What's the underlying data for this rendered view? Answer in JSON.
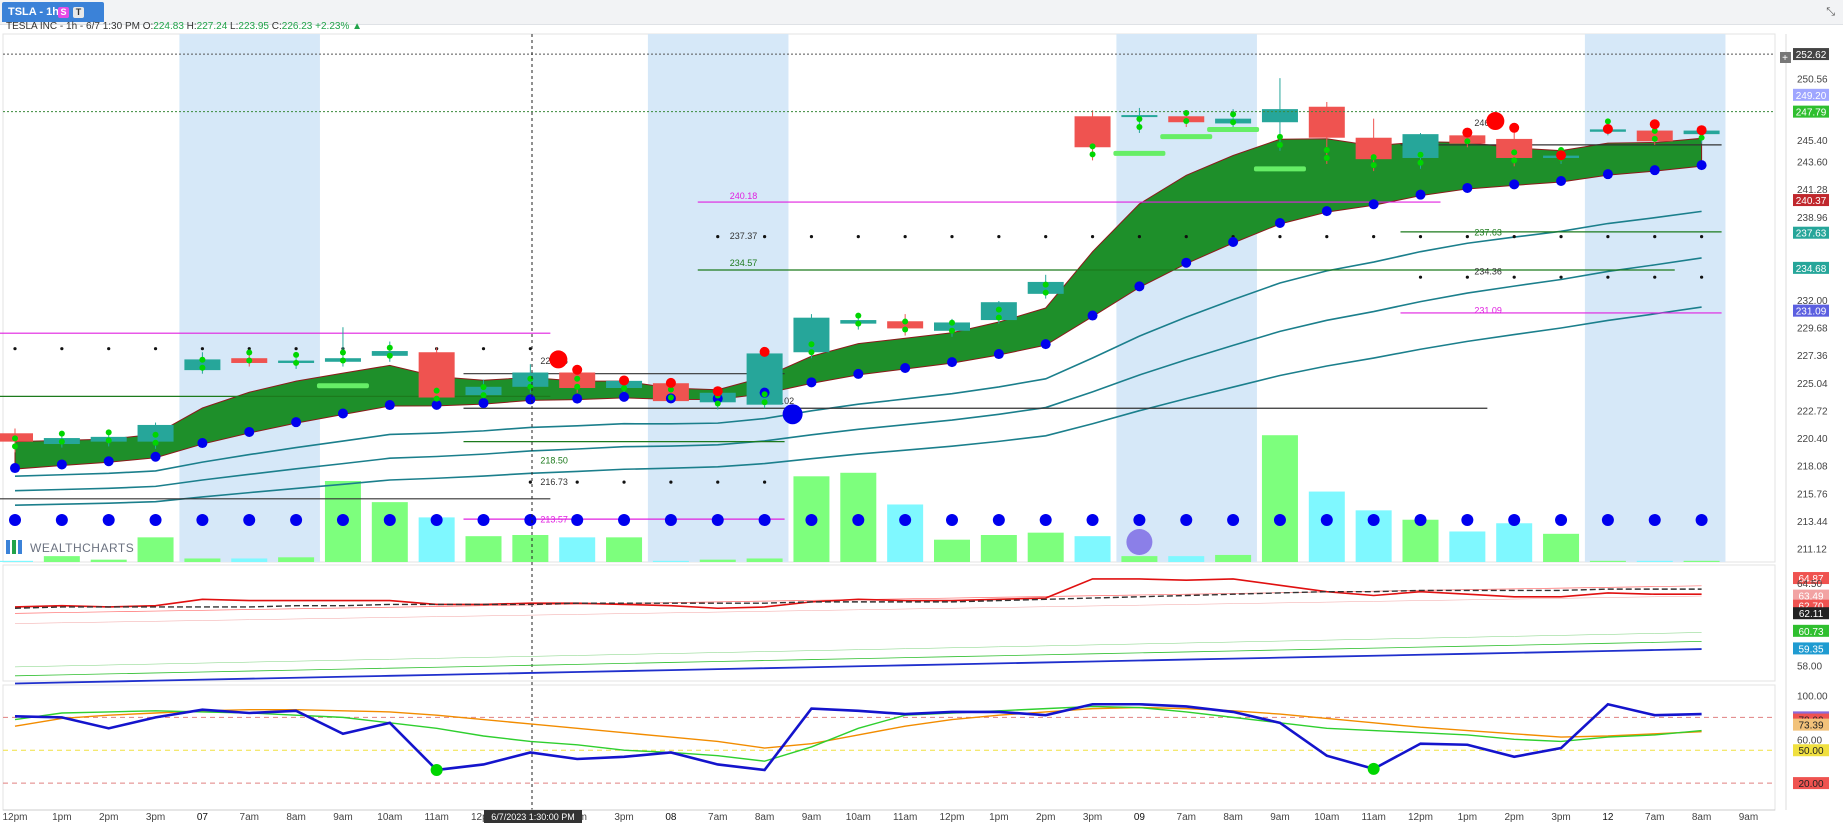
{
  "tab": {
    "label": "TSLA - 1hr",
    "badge_s": "S",
    "badge_t": "T"
  },
  "top_right_icon": "expand-icon",
  "info": {
    "title": "TESLA INC - 1h - 6/7 1:30 PM",
    "o_label": "O:",
    "o_value": "224.83",
    "h_label": "H:",
    "h_value": "227.24",
    "l_label": "L:",
    "l_value": "223.95",
    "c_label": "C:",
    "c_value": "226.23",
    "change": "+2.23%",
    "arrow": "▲"
  },
  "watermark": "WEALTHCHARTS",
  "crosshair_label": "6/7/2023 1:30:00 PM",
  "colors": {
    "up": "#26a69a",
    "down": "#ef5350",
    "cloud": "#1e8f2a",
    "session": "#d6e8f8",
    "volume_up": "#7dff7d",
    "volume_down": "#7ff8ff",
    "dots_blue": "#0000ee",
    "dots_red": "#ff0000",
    "dots_green": "#00d600",
    "magenta": "#e020e0"
  },
  "chart_data": [
    {
      "type": "candlestick",
      "x": [
        "12pm",
        "1pm",
        "2pm",
        "3pm",
        "07",
        "7am",
        "8am",
        "9am",
        "10am",
        "11am",
        "12pm",
        "1pm",
        "2pm",
        "3pm",
        "08",
        "7am",
        "8am",
        "9am",
        "10am",
        "11am",
        "12pm",
        "1pm",
        "2pm",
        "3pm",
        "09",
        "7am",
        "8am",
        "9am",
        "10am",
        "11am",
        "12pm",
        "1pm",
        "2pm",
        "3pm",
        "12",
        "7am",
        "8am"
      ],
      "ohlc": [
        [
          220.8,
          221.2,
          219.2,
          220.1
        ],
        [
          219.9,
          220.7,
          219.6,
          220.4
        ],
        [
          220.1,
          220.7,
          219.7,
          220.5
        ],
        [
          220.1,
          221.7,
          219.5,
          221.5
        ],
        [
          226.1,
          227.6,
          225.8,
          227.0
        ],
        [
          227.1,
          227.5,
          226.4,
          226.7
        ],
        [
          226.7,
          227.1,
          226.2,
          226.9
        ],
        [
          226.8,
          229.7,
          226.4,
          227.1
        ],
        [
          227.3,
          228.5,
          226.8,
          227.7
        ],
        [
          227.6,
          228.0,
          223.2,
          223.8
        ],
        [
          224.0,
          225.3,
          223.5,
          224.7
        ],
        [
          224.7,
          226.6,
          224.2,
          225.9
        ],
        [
          225.9,
          226.3,
          224.2,
          224.6
        ],
        [
          224.6,
          225.4,
          224.1,
          225.2
        ],
        [
          225.0,
          225.2,
          223.3,
          223.5
        ],
        [
          223.4,
          224.5,
          222.8,
          224.2
        ],
        [
          223.2,
          227.8,
          222.9,
          227.5
        ],
        [
          227.6,
          230.8,
          227.1,
          230.5
        ],
        [
          230.0,
          230.7,
          229.5,
          230.3
        ],
        [
          230.2,
          230.8,
          229.0,
          229.6
        ],
        [
          229.4,
          230.4,
          228.9,
          230.1
        ],
        [
          230.3,
          231.9,
          230.0,
          231.8
        ],
        [
          232.5,
          234.1,
          232.1,
          233.5
        ],
        [
          247.4,
          247.9,
          243.7,
          244.8
        ],
        [
          247.4,
          248.1,
          246.0,
          247.5
        ],
        [
          247.4,
          247.9,
          246.5,
          246.9
        ],
        [
          246.8,
          248.0,
          246.4,
          247.2
        ],
        [
          246.9,
          250.6,
          244.5,
          248.0
        ],
        [
          248.2,
          248.6,
          243.4,
          245.6
        ],
        [
          245.6,
          247.2,
          242.8,
          243.8
        ],
        [
          243.9,
          246.0,
          243.0,
          245.9
        ],
        [
          245.8,
          246.2,
          244.8,
          245.1
        ],
        [
          245.5,
          246.6,
          243.2,
          243.9
        ],
        [
          243.9,
          244.3,
          243.4,
          244.1
        ],
        [
          246.1,
          246.5,
          245.8,
          246.3
        ],
        [
          246.2,
          246.9,
          245.0,
          245.3
        ],
        [
          245.9,
          246.4,
          245.1,
          246.2
        ]
      ],
      "volume": [
        0.1,
        0.5,
        0.2,
        2.1,
        0.3,
        0.3,
        0.4,
        6.9,
        5.1,
        3.8,
        2.2,
        2.3,
        2.1,
        2.1,
        0.1,
        0.2,
        0.3,
        7.3,
        7.6,
        4.9,
        1.9,
        2.3,
        2.5,
        2.2,
        0.5,
        0.5,
        0.6,
        10.8,
        6.0,
        4.4,
        3.6,
        2.6,
        3.3,
        2.4,
        0.1,
        0.1,
        0.1
      ],
      "axis_labels": [
        "252.62",
        "250.56",
        "249.20",
        "247.79",
        "245.40",
        "243.60",
        "241.28",
        "240.37",
        "238.96",
        "237.63",
        "234.68",
        "232.00",
        "231.09",
        "229.68",
        "227.36",
        "225.04",
        "222.72",
        "220.40",
        "218.08",
        "215.76",
        "213.44",
        "211.12"
      ],
      "price_labels": {
        "p240_18": "240.18",
        "p237_37": "237.37",
        "p234_57": "234.57",
        "p226_36": "226.36",
        "p223_02": "223.02",
        "p218_50": "218.50",
        "p216_73": "216.73",
        "p213_57": "213.57",
        "p246_84": "246.84",
        "p237_63": "237.63",
        "p234_36": "234.36",
        "p231_09": "231.09"
      },
      "ylim": [
        210,
        253.8
      ]
    },
    {
      "type": "line",
      "axis_labels": [
        "64.87",
        "64.50",
        "63.49",
        "62.70",
        "62.11",
        "60.73",
        "59.35",
        "58.00"
      ],
      "series": [
        {
          "values": [
            62.6,
            62.7,
            62.6,
            62.7,
            63.2,
            63.1,
            63.1,
            63.1,
            63.1,
            62.8,
            62.8,
            62.9,
            62.9,
            62.8,
            62.7,
            62.5,
            62.6,
            63.0,
            63.2,
            63.1,
            63.1,
            63.2,
            63.3,
            64.8,
            64.8,
            64.7,
            64.8,
            64.3,
            63.8,
            63.5,
            63.8,
            63.6,
            63.4,
            63.4,
            63.7,
            63.6,
            63.6
          ]
        },
        {
          "values": [
            62.5,
            62.6,
            62.6,
            62.6,
            62.6,
            62.6,
            62.7,
            62.7,
            62.8,
            62.8,
            62.8,
            62.8,
            62.9,
            62.9,
            62.9,
            62.9,
            62.9,
            63.0,
            63.0,
            63.0,
            63.0,
            63.1,
            63.2,
            63.3,
            63.4,
            63.5,
            63.6,
            63.7,
            63.8,
            63.8,
            63.9,
            63.9,
            63.9,
            63.9,
            64.0,
            64.0,
            64.0
          ]
        }
      ]
    },
    {
      "type": "line",
      "axis_labels": [
        "100.00",
        "80.00",
        "78.00",
        "73.39",
        "60.00",
        "50.00",
        "20.00"
      ],
      "series": [
        {
          "values": [
            81,
            80,
            70,
            80,
            87,
            84,
            86,
            65,
            75,
            32,
            37,
            48,
            42,
            44,
            48,
            37,
            32,
            88,
            86,
            83,
            85,
            85,
            82,
            92,
            92,
            90,
            85,
            75,
            45,
            33,
            56,
            55,
            44,
            52,
            92,
            82,
            83
          ]
        },
        {
          "values": [
            78,
            84,
            85,
            86,
            85,
            84,
            82,
            80,
            75,
            70,
            63,
            58,
            55,
            50,
            48,
            45,
            40,
            53,
            70,
            82,
            84,
            86,
            88,
            90,
            89,
            85,
            80,
            75,
            70,
            68,
            66,
            64,
            60,
            58,
            62,
            64,
            68
          ]
        },
        {
          "values": [
            72,
            79,
            82,
            84,
            86,
            87,
            87,
            86,
            85,
            82,
            78,
            74,
            70,
            66,
            62,
            58,
            52,
            56,
            64,
            72,
            78,
            82,
            85,
            88,
            89,
            88,
            86,
            83,
            79,
            75,
            71,
            68,
            65,
            62,
            63,
            65,
            67
          ]
        }
      ]
    }
  ],
  "x_axis_labels": [
    "12pm",
    "1pm",
    "2pm",
    "3pm",
    "07",
    "7am",
    "8am",
    "9am",
    "10am",
    "11am",
    "12pm",
    "1pm",
    "2pm",
    "3pm",
    "08",
    "7am",
    "8am",
    "9am",
    "10am",
    "11am",
    "12pm",
    "1pm",
    "2pm",
    "3pm",
    "09",
    "7am",
    "8am",
    "9am",
    "10am",
    "11am",
    "12pm",
    "1pm",
    "2pm",
    "3pm",
    "12",
    "7am",
    "8am",
    "9am"
  ]
}
